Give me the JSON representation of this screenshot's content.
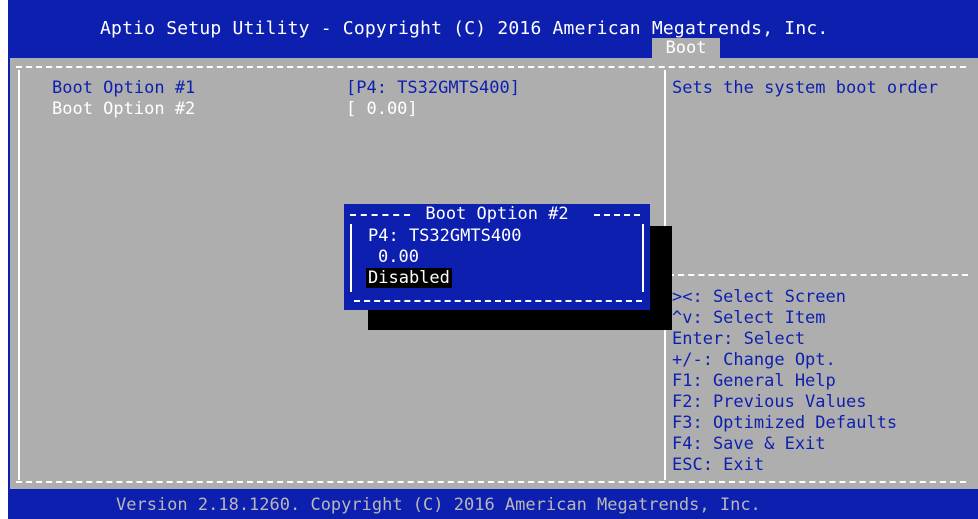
{
  "header": {
    "title": "Aptio Setup Utility - Copyright (C) 2016 American Megatrends, Inc.",
    "active_tab": "Boot"
  },
  "settings": [
    {
      "label": "Boot Option #1",
      "value": "[P4: TS32GMTS400]",
      "selected": false
    },
    {
      "label": "Boot Option #2",
      "value": "[ 0.00]",
      "selected": true
    }
  ],
  "help": {
    "description": "Sets the system boot order"
  },
  "keys": [
    "><: Select Screen",
    "^v: Select Item",
    "Enter: Select",
    "+/-: Change Opt.",
    "F1: General Help",
    "F2: Previous Values",
    "F3: Optimized Defaults",
    "F4: Save & Exit",
    "ESC: Exit"
  ],
  "popup": {
    "title": "Boot Option #2",
    "options": [
      "P4: TS32GMTS400",
      "0.00",
      "Disabled"
    ],
    "highlighted": "Disabled"
  },
  "footer": {
    "text": "Version 2.18.1260. Copyright (C) 2016 American Megatrends, Inc."
  },
  "colors": {
    "bios_blue": "#0d1fae",
    "bios_gray": "#aeaeae",
    "text_white": "#ffffff",
    "highlight_black": "#000000"
  }
}
